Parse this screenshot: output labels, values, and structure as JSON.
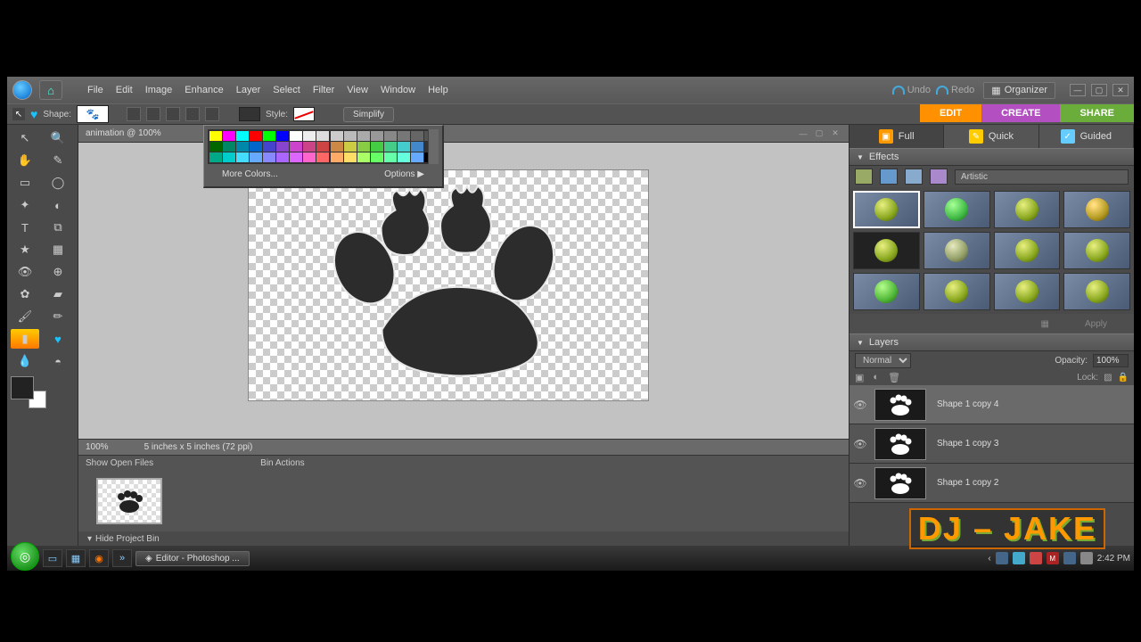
{
  "menu": [
    "File",
    "Edit",
    "Image",
    "Enhance",
    "Layer",
    "Select",
    "Filter",
    "View",
    "Window",
    "Help"
  ],
  "undo": "Undo",
  "redo": "Redo",
  "organizer": "Organizer",
  "optbar": {
    "shape_label": "Shape:",
    "style_label": "Style:",
    "simplify": "Simplify"
  },
  "main_tabs": {
    "edit": "EDIT",
    "create": "CREATE",
    "share": "SHARE"
  },
  "doc_title": "animation @ 100%",
  "color_popup": {
    "more": "More Colors...",
    "options": "Options  ▶",
    "rows": [
      [
        "#ff0",
        "#f0f",
        "#0ff",
        "#f00",
        "#0f0",
        "#00f",
        "#fff",
        "#eee",
        "#ddd",
        "#ccc",
        "#bbb",
        "#aaa",
        "#999",
        "#888",
        "#777",
        "#666",
        "#555"
      ],
      [
        "#060",
        "#086",
        "#08a",
        "#06c",
        "#44c",
        "#84c",
        "#c4c",
        "#c48",
        "#c44",
        "#c84",
        "#cc4",
        "#8c4",
        "#4c4",
        "#4c8",
        "#4cc",
        "#48c",
        "#333"
      ],
      [
        "#0a8",
        "#0cc",
        "#4df",
        "#6af",
        "#88f",
        "#a6f",
        "#d6f",
        "#f6c",
        "#f66",
        "#fa6",
        "#fd6",
        "#af6",
        "#6f6",
        "#6fa",
        "#6fd",
        "#6af",
        "#000"
      ]
    ]
  },
  "status": {
    "zoom": "100%",
    "dims": "5 inches x 5 inches (72 ppi)"
  },
  "bin_head": {
    "show": "Show Open Files",
    "actions": "Bin Actions"
  },
  "hide_bin": "Hide Project Bin",
  "mode_tabs": [
    "Full",
    "Quick",
    "Guided"
  ],
  "effects": {
    "title": "Effects",
    "category": "Artistic",
    "apply": "Apply"
  },
  "layers_panel": {
    "title": "Layers",
    "blend": "Normal",
    "opacity_label": "Opacity:",
    "opacity": "100%",
    "lock": "Lock:",
    "items": [
      {
        "name": "Shape 1 copy 4",
        "selected": true
      },
      {
        "name": "Shape 1 copy 3",
        "selected": false
      },
      {
        "name": "Shape 1 copy 2",
        "selected": false
      }
    ]
  },
  "taskbar": {
    "app": "Editor - Photoshop ...",
    "time": "2:42 PM"
  },
  "watermark": "DJ – JAKE"
}
